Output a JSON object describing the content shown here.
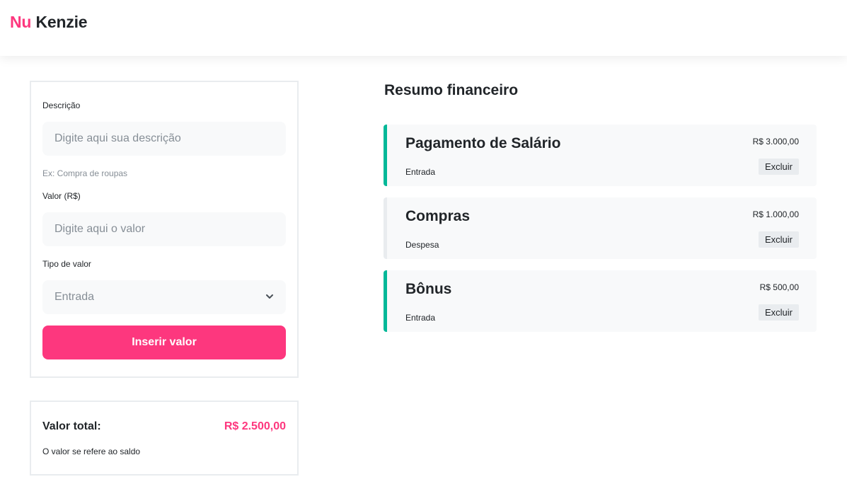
{
  "header": {
    "logo_part1": "Nu",
    "logo_part2": "Kenzie"
  },
  "form": {
    "description_label": "Descrição",
    "description_placeholder": "Digite aqui sua descrição",
    "description_hint": "Ex: Compra de roupas",
    "value_label": "Valor (R$)",
    "value_placeholder": "Digite aqui o valor",
    "type_label": "Tipo de valor",
    "type_selected": "Entrada",
    "submit_label": "Inserir valor"
  },
  "total": {
    "label": "Valor total:",
    "value": "R$ 2.500,00",
    "note": "O valor se refere ao saldo"
  },
  "summary": {
    "title": "Resumo financeiro",
    "entries": [
      {
        "description": "Pagamento de Salário",
        "type": "Entrada",
        "value": "R$ 3.000,00",
        "delete_label": "Excluir"
      },
      {
        "description": "Compras",
        "type": "Despesa",
        "value": "R$ 1.000,00",
        "delete_label": "Excluir"
      },
      {
        "description": "Bônus",
        "type": "Entrada",
        "value": "R$ 500,00",
        "delete_label": "Excluir"
      }
    ]
  },
  "colors": {
    "brand": "#fd377e",
    "entrada_accent": "#03b898",
    "despesa_accent": "#e9ecef"
  }
}
